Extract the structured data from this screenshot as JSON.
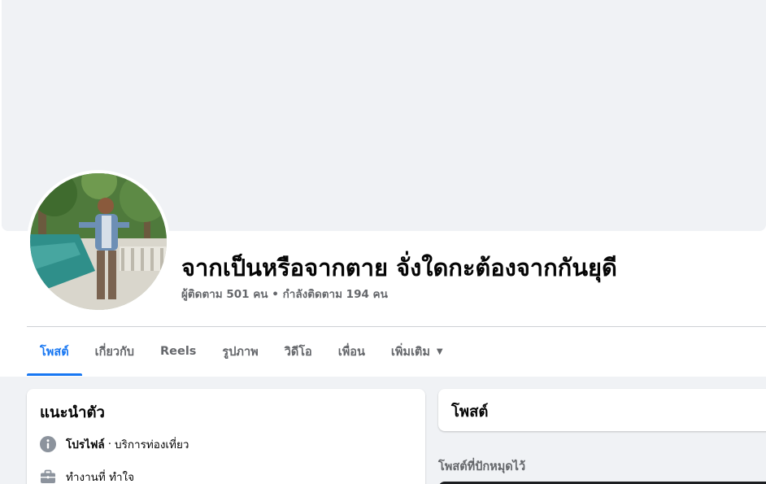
{
  "profile": {
    "name": "จากเป็นหรือจากตาย จั่งใดกะต้องจากกันยุดี",
    "followers": "ผู้ติดตาม 501 คน",
    "separator": "•",
    "following": "กำลังติดตาม 194 คน"
  },
  "tabs": [
    {
      "label": "โพสต์",
      "active": true
    },
    {
      "label": "เกี่ยวกับ"
    },
    {
      "label": "Reels"
    },
    {
      "label": "รูปภาพ"
    },
    {
      "label": "วิดีโอ"
    },
    {
      "label": "เพื่อน"
    },
    {
      "label": "เพิ่มเติม",
      "icon": "caret-down-icon",
      "caret": "▼"
    }
  ],
  "intro": {
    "title": "แนะนำตัว",
    "profile_label": "โปรไฟล์",
    "profile_sep": "·",
    "profile_category": "บริการท่องเที่ยว",
    "work": "ทำงานที่ ทำใจ"
  },
  "posts": {
    "title": "โพสต์",
    "pinned_label": "โพสต์ที่ปักหมุดไว้"
  },
  "colors": {
    "accent": "#1877f2",
    "secondary_text": "#65676b",
    "background": "#f0f2f5"
  }
}
